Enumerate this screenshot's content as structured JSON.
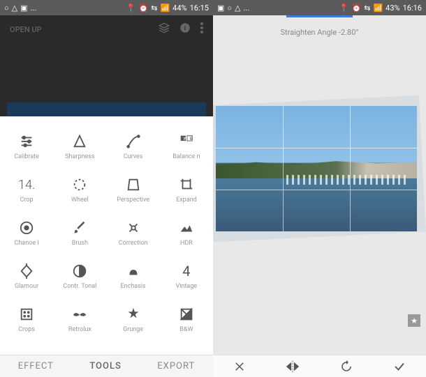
{
  "status": {
    "left_icons": [
      "circle",
      "triangle",
      "square",
      "dots"
    ],
    "right_icons": [
      "location",
      "alarm",
      "wifi",
      "signal"
    ],
    "battery_left": "44%",
    "time_left": "16:15",
    "battery_right": "43%",
    "time_right": "16:16"
  },
  "left": {
    "dark_title": "OPEN UP",
    "tabs": {
      "effect": "EFFECT",
      "tools": "TOOLS",
      "export": "EXPORT"
    },
    "tools": [
      {
        "icon": "calibrate",
        "label": "Calibrate"
      },
      {
        "icon": "sharpness",
        "label": "Sharpness"
      },
      {
        "icon": "curves",
        "label": "Curves"
      },
      {
        "icon": "balance",
        "label": "Balance n"
      },
      {
        "icon": "crop",
        "label": "Crop",
        "text": "14."
      },
      {
        "icon": "wheel",
        "label": "Wheel"
      },
      {
        "icon": "perspective",
        "label": "Perspective"
      },
      {
        "icon": "expand",
        "label": "Expand"
      },
      {
        "icon": "selective",
        "label": "Chanoe i"
      },
      {
        "icon": "brush",
        "label": "Brush"
      },
      {
        "icon": "correction",
        "label": "Correction"
      },
      {
        "icon": "hdr",
        "label": "HDR"
      },
      {
        "icon": "glamour",
        "label": "Glamour"
      },
      {
        "icon": "tonal",
        "label": "Contr. Tonal"
      },
      {
        "icon": "enchasis",
        "label": "Enchasis"
      },
      {
        "icon": "vintage",
        "label": "Vintage"
      },
      {
        "icon": "crops",
        "label": "Crops"
      },
      {
        "icon": "retro",
        "label": "Retrolux"
      },
      {
        "icon": "grunge",
        "label": "Grunge"
      },
      {
        "icon": "bw",
        "label": "B&W"
      }
    ]
  },
  "right": {
    "straighten_label": "Straighten Angle",
    "angle_value": "-2.80°",
    "buttons": {
      "cancel": "close",
      "flip": "flip",
      "rotate": "rotate",
      "confirm": "check"
    }
  }
}
